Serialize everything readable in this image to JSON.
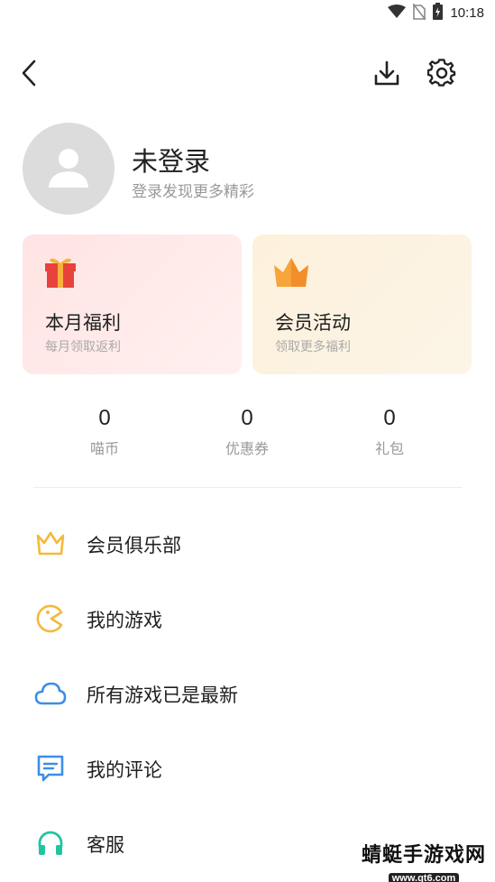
{
  "status_bar": {
    "time": "10:18",
    "icons": [
      "wifi-icon",
      "no-sim-icon",
      "battery-charging-icon"
    ]
  },
  "topbar": {
    "icons": [
      "back-arrow-icon",
      "download-icon",
      "settings-gear-icon"
    ]
  },
  "profile": {
    "name": "未登录",
    "subtitle": "登录发现更多精彩",
    "avatar_icon": "default-user-icon"
  },
  "cards": [
    {
      "title": "本月福利",
      "subtitle": "每月领取返利",
      "icon": "gift-icon",
      "accent": "#e8423d"
    },
    {
      "title": "会员活动",
      "subtitle": "领取更多福利",
      "icon": "crown-icon",
      "accent": "#f7a43a"
    }
  ],
  "stats": [
    {
      "value": "0",
      "label": "喵币"
    },
    {
      "value": "0",
      "label": "优惠券"
    },
    {
      "value": "0",
      "label": "礼包"
    }
  ],
  "menu": [
    {
      "label": "会员俱乐部",
      "icon": "crown-outline-icon",
      "color": "#f5b93a"
    },
    {
      "label": "我的游戏",
      "icon": "pacman-icon",
      "color": "#f5b93a"
    },
    {
      "label": "所有游戏已是最新",
      "icon": "cloud-icon",
      "color": "#3d8ee6"
    },
    {
      "label": "我的评论",
      "icon": "comment-icon",
      "color": "#3d8ee6"
    },
    {
      "label": "客服",
      "icon": "headset-icon",
      "color": "#22c4a0"
    }
  ],
  "watermark": {
    "name": "蜻蜓手游戏网",
    "url": "www.qt6.com"
  }
}
